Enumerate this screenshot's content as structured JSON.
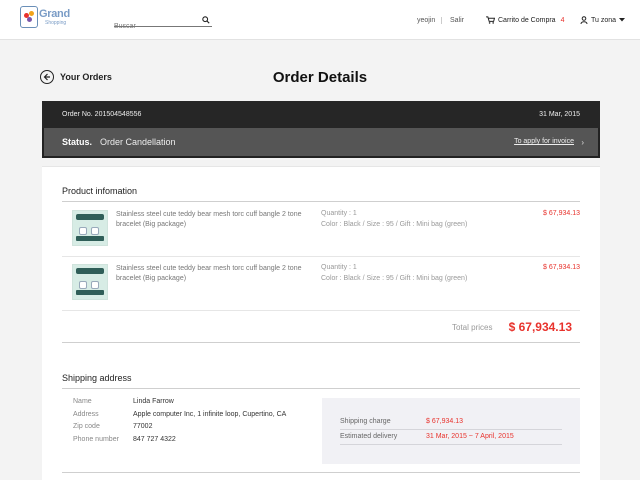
{
  "header": {
    "logo": {
      "brand": "Grand",
      "sub": "Shopping"
    },
    "search": {
      "placeholder": "Buscar"
    },
    "user": "yeojin",
    "logout": "Salir",
    "cart": {
      "label": "Carrito de Compra",
      "count": "4"
    },
    "zone": "Tu zona"
  },
  "title_row": {
    "back_label": "Your Orders",
    "page_title": "Order Details"
  },
  "order": {
    "number": "Order No. 201504548556",
    "date": "31 Mar, 2015",
    "status_label": "Status.",
    "status_value": "Order Candellation",
    "invoice_link": "To apply for invoice"
  },
  "products": {
    "section_title": "Product infomation",
    "items": [
      {
        "name": "Stainless steel cute teddy bear mesh torc cuff bangle 2 tone bracelet (Big package)",
        "quantity": "Quantity : 1",
        "options": "Color : Black / Size : 95 / Gift : Mini bag (green)",
        "price": "$ 67,934.13"
      },
      {
        "name": "Stainless steel cute teddy bear mesh torc cuff bangle 2 tone bracelet (Big package)",
        "quantity": "Quantity : 1",
        "options": "Color : Black / Size : 95 / Gift : Mini bag (green)",
        "price": "$ 67,934.13"
      }
    ],
    "total_label": "Total prices",
    "total_value": "$ 67,934.13"
  },
  "shipping": {
    "section_title": "Shipping address",
    "rows": [
      {
        "label": "Name",
        "value": "Linda Farrow"
      },
      {
        "label": "Address",
        "value": "Apple computer Inc, 1 infinite loop, Cupertino, CA"
      },
      {
        "label": "Zip code",
        "value": "77002"
      },
      {
        "label": "Phone number",
        "value": "847 727 4322"
      }
    ],
    "charge_label": "Shipping charge",
    "charge_value": "$ 67,934.13",
    "delivery_label": "Estimated delivery",
    "delivery_value": "31 Mar, 2015 ~ 7 April, 2015"
  },
  "colors": {
    "accent": "#e8322c",
    "dark_bar": "#262626",
    "status_bar": "#555555"
  }
}
